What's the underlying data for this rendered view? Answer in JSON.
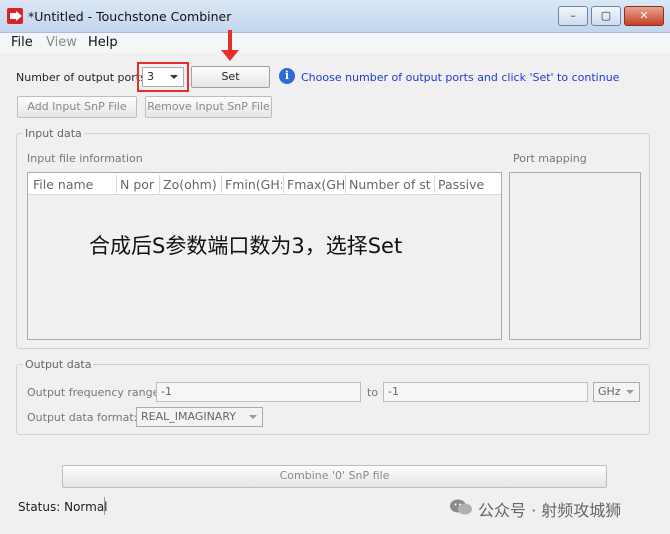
{
  "window": {
    "title": "*Untitled - Touchstone Combiner",
    "min": "–",
    "max": "▢",
    "close": "✕"
  },
  "menu": {
    "items": [
      "File",
      "View",
      "Help"
    ]
  },
  "top": {
    "ports_label": "Number of output ports",
    "ports_value": "3",
    "set_button": "Set",
    "hint": "Choose number of output ports and click 'Set' to continue",
    "add_button": "Add Input SnP File",
    "remove_button": "Remove Input SnP File"
  },
  "input_data": {
    "group_title": "Input data",
    "file_info_label": "Input file information",
    "port_mapping_label": "Port mapping",
    "columns": [
      "File name",
      "N por",
      "Zo(ohm)",
      "Fmin(GH:",
      "Fmax(GH",
      "Number of st",
      "Passive"
    ]
  },
  "output_data": {
    "group_title": "Output data",
    "freq_label": "Output frequency range:",
    "freq_min": "-1",
    "to_label": "to",
    "freq_max": "-1",
    "unit": "GHz",
    "format_label": "Output data format:",
    "format_value": "REAL_IMAGINARY"
  },
  "combine_button": "Combine '0' SnP file",
  "status": "Status: Normal",
  "annotation": {
    "caption": "合成后S参数端口数为3，选择Set",
    "colors": {
      "highlight": "#e2312d"
    }
  },
  "watermark": "公众号 · 射频攻城狮"
}
